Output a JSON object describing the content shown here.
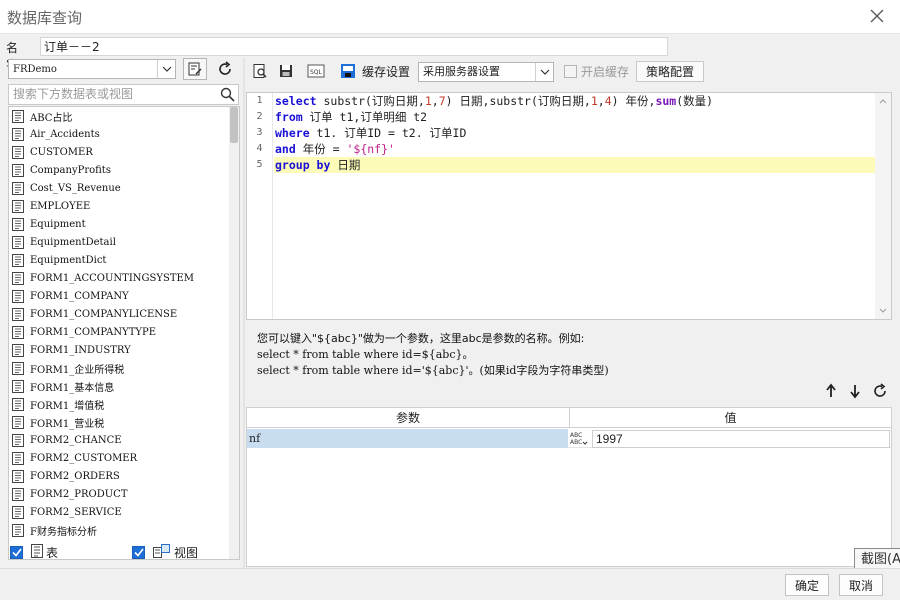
{
  "window": {
    "title": "数据库查询"
  },
  "name_field": {
    "label": "名字:",
    "value": "订单－－2"
  },
  "left": {
    "connection": "FRDemo",
    "search_placeholder": "搜索下方数据表或视图",
    "tables": [
      "ABC占比",
      "Air_Accidents",
      "CUSTOMER",
      "CompanyProfits",
      "Cost_VS_Revenue",
      "EMPLOYEE",
      "Equipment",
      "EquipmentDetail",
      "EquipmentDict",
      "FORM1_ACCOUNTINGSYSTEM",
      "FORM1_COMPANY",
      "FORM1_COMPANYLICENSE",
      "FORM1_COMPANYTYPE",
      "FORM1_INDUSTRY",
      "FORM1_企业所得税",
      "FORM1_基本信息",
      "FORM1_增值税",
      "FORM1_营业税",
      "FORM2_CHANCE",
      "FORM2_CUSTOMER",
      "FORM2_ORDERS",
      "FORM2_PRODUCT",
      "FORM2_SERVICE",
      "F财务指标分析"
    ],
    "filter_table_label": "表",
    "filter_view_label": "视图"
  },
  "toolbar": {
    "cache_label": "缓存设置",
    "cache_option": "采用服务器设置",
    "enable_cache_label": "开启缓存",
    "strategy_label": "策略配置"
  },
  "editor": {
    "line_numbers": [
      "1",
      "2",
      "3",
      "4",
      "5"
    ],
    "lines": [
      [
        [
          "kw",
          "select"
        ],
        [
          "t",
          " substr(订购日期,"
        ],
        [
          "num",
          "1"
        ],
        [
          "t",
          ","
        ],
        [
          "num",
          "7"
        ],
        [
          "t",
          ") 日期,substr(订购日期,"
        ],
        [
          "num",
          "1"
        ],
        [
          "t",
          ","
        ],
        [
          "num",
          "4"
        ],
        [
          "t",
          ") 年份,"
        ],
        [
          "fn",
          "sum"
        ],
        [
          "t",
          "(数量)"
        ]
      ],
      [
        [
          "kw",
          "from"
        ],
        [
          "t",
          " 订单 t1,订单明细 t2"
        ]
      ],
      [
        [
          "kw",
          "where"
        ],
        [
          "t",
          " t1. 订单ID = t2. 订单ID"
        ]
      ],
      [
        [
          "kw",
          "and"
        ],
        [
          "t",
          " 年份 = "
        ],
        [
          "str",
          "'${nf}'"
        ]
      ],
      [
        [
          "kw",
          "group by"
        ],
        [
          "t",
          " 日期"
        ]
      ]
    ]
  },
  "hint": {
    "line1": "您可以键入\"${abc}\"做为一个参数，这里abc是参数的名称。例如:",
    "line2": "select * from table where id=${abc}。",
    "line3": "select * from table where id='${abc}'。(如果id字段为字符串类型)"
  },
  "params": {
    "col_param": "参数",
    "col_value": "值",
    "rows": [
      {
        "name": "nf",
        "value": "1997"
      }
    ]
  },
  "tooltip": "截图(Alt+A)",
  "buttons": {
    "ok": "确定",
    "cancel": "取消"
  },
  "colors": {
    "accent": "#1e6ed8",
    "highlight_line": "#fcfcb8",
    "selected_param": "#c9ddf0"
  }
}
